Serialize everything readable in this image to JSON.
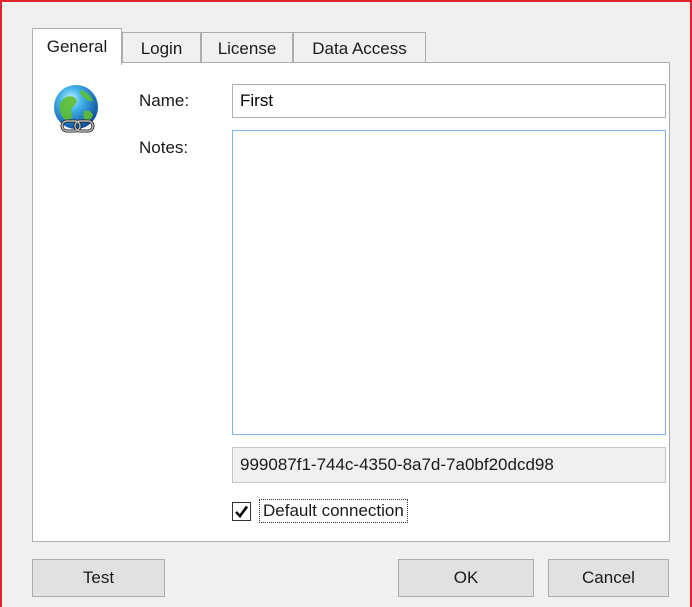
{
  "tabs": [
    {
      "label": "General",
      "active": true
    },
    {
      "label": "Login",
      "active": false
    },
    {
      "label": "License",
      "active": false
    },
    {
      "label": "Data Access",
      "active": false
    }
  ],
  "form": {
    "name_label": "Name:",
    "name_value": "First",
    "notes_label": "Notes:",
    "notes_value": "",
    "guid_value": "999087f1-744c-4350-8a7d-7a0bf20dcd98",
    "default_connection_label": "Default connection",
    "default_connection_checked": true
  },
  "buttons": {
    "test_label": "Test",
    "ok_label": "OK",
    "cancel_label": "Cancel"
  },
  "icons": {
    "connection": "globe-chain-icon",
    "check": "checkmark-icon"
  },
  "colors": {
    "window_border": "#e0262b",
    "notes_focus_border": "#7eb4ea"
  }
}
